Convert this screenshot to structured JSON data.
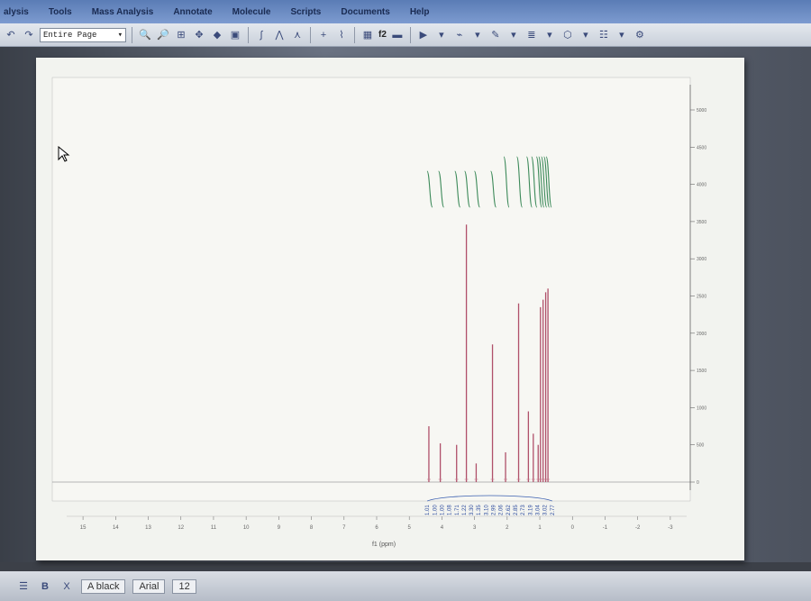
{
  "menu": [
    "alysis",
    "Tools",
    "Mass Analysis",
    "Annotate",
    "Molecule",
    "Scripts",
    "Documents",
    "Help"
  ],
  "toolbar": {
    "zoom_value": "Entire Page",
    "number_label": "f2"
  },
  "spectrum": {
    "xlabel": "f1 (ppm)",
    "x_ticks": [
      "15",
      "14",
      "13",
      "12",
      "11",
      "10",
      "9",
      "8",
      "7",
      "6",
      "5",
      "4",
      "3",
      "2",
      "1",
      "0",
      "-1",
      "-2",
      "-3"
    ],
    "y_ticks": [
      "5000",
      "4500",
      "4000",
      "3500",
      "3000",
      "2500",
      "2000",
      "1500",
      "1000",
      "500",
      "0"
    ],
    "integrals": [
      "1.01",
      "1.00",
      "1.00",
      "1.08",
      "1.71",
      "1.22",
      "3.30",
      "1.35",
      "3.10",
      "2.99",
      "2.06",
      "2.62",
      "2.85",
      "2.73",
      "3.19",
      "3.04",
      "3.02",
      "2.77"
    ]
  },
  "chart_data": {
    "type": "line",
    "xlabel": "f1 (ppm)",
    "xlim": [
      15.5,
      -3.5
    ],
    "ylim": [
      -200,
      5200
    ],
    "grid": false,
    "peaks": [
      {
        "ppm": 4.4,
        "height": 750
      },
      {
        "ppm": 4.05,
        "height": 520
      },
      {
        "ppm": 3.55,
        "height": 500
      },
      {
        "ppm": 3.25,
        "height": 3460
      },
      {
        "ppm": 2.95,
        "height": 250
      },
      {
        "ppm": 2.45,
        "height": 1850
      },
      {
        "ppm": 2.05,
        "height": 400
      },
      {
        "ppm": 1.65,
        "height": 2400
      },
      {
        "ppm": 1.35,
        "height": 950
      },
      {
        "ppm": 1.2,
        "height": 650
      },
      {
        "ppm": 1.05,
        "height": 500
      },
      {
        "ppm": 0.98,
        "height": 2350
      },
      {
        "ppm": 0.9,
        "height": 2450
      },
      {
        "ppm": 0.82,
        "height": 2550
      },
      {
        "ppm": 0.75,
        "height": 2600
      }
    ]
  },
  "bottom": {
    "format_label": "A black",
    "font_label": "Arial",
    "size_label": "12"
  }
}
